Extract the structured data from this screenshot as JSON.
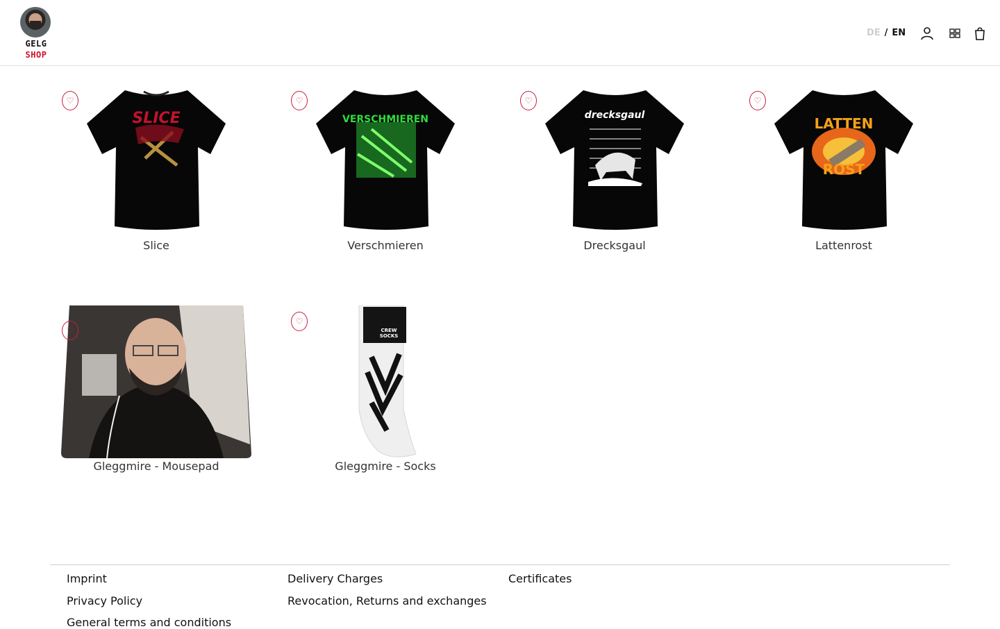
{
  "header": {
    "logo_line1": "GELG",
    "logo_line2": "SHOP",
    "lang_de": "DE",
    "lang_sep": "/",
    "lang_en": "EN",
    "icons": [
      "user-icon",
      "grid-icon",
      "cart-icon"
    ]
  },
  "products": [
    {
      "name": "Slice",
      "art": "SLICE",
      "art_color": "#c3122c"
    },
    {
      "name": "Verschmieren",
      "art": "VERSCHMIEREN",
      "art_color": "#2ddc3a"
    },
    {
      "name": "Drecksgaul",
      "art": "drecksgaul",
      "art_color": "#ffffff"
    },
    {
      "name": "Lattenrost",
      "art_top": "LATTEN",
      "art_bottom": "ROST",
      "art_color": "#f4a11a"
    },
    {
      "name": "Gleggmire - Mousepad"
    },
    {
      "name": "Gleggmire - Socks",
      "art": "CREW SOCKS"
    }
  ],
  "footer": {
    "col1": [
      "Imprint",
      "Privacy Policy",
      "General terms and conditions"
    ],
    "col2": [
      "Delivery Charges",
      "Revocation, Returns and exchanges"
    ],
    "col3": [
      "Certificates"
    ]
  },
  "colors": {
    "accent": "#c81d3e",
    "border": "#e3e3e3"
  }
}
